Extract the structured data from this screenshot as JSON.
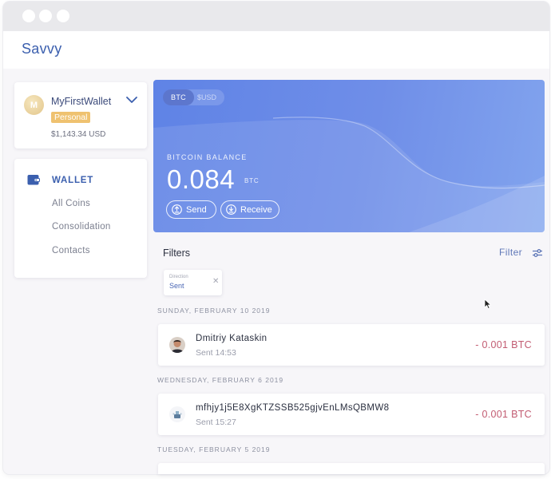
{
  "window": {
    "title": "Savvy"
  },
  "wallet_card": {
    "avatar_letter": "M",
    "name": "MyFirstWallet",
    "badge": "Personal",
    "balance_usd": "$1,143.34 USD"
  },
  "sidebar": {
    "heading": "WALLET",
    "items": [
      {
        "label": "All Coins"
      },
      {
        "label": "Consolidation"
      },
      {
        "label": "Contacts"
      }
    ]
  },
  "hero": {
    "tabs": [
      {
        "label": "BTC",
        "active": true
      },
      {
        "label": "$USD",
        "active": false
      }
    ],
    "balance_label": "BITCOIN BALANCE",
    "balance_value": "0.084",
    "balance_unit": "BTC",
    "send_label": "Send",
    "receive_label": "Receive"
  },
  "filters": {
    "title": "Filters",
    "filter_link": "Filter",
    "chip": {
      "label": "Direction",
      "value": "Sent"
    }
  },
  "transactions": {
    "groups": [
      {
        "date": "SUNDAY, FEBRUARY 10 2019",
        "items": [
          {
            "name": "Dmitriy Kataskin",
            "sub": "Sent 14:53",
            "amount": "- 0.001 BTC",
            "avatar": "person-avatar"
          }
        ]
      },
      {
        "date": "WEDNESDAY, FEBRUARY 6 2019",
        "items": [
          {
            "name": "mfhjy1j5E8XgKTZSSB525gjvEnLMsQBMW8",
            "sub": "Sent 15:27",
            "amount": "- 0.001 BTC",
            "avatar": "address-avatar"
          }
        ]
      },
      {
        "date": "TUESDAY, FEBRUARY 5 2019",
        "items": []
      }
    ]
  },
  "colors": {
    "accent": "#3b5fae",
    "hero_gradient_start": "#5f83e6",
    "hero_gradient_end": "#82a4ee",
    "badge": "#efc270",
    "negative_amount": "#c25c72"
  }
}
